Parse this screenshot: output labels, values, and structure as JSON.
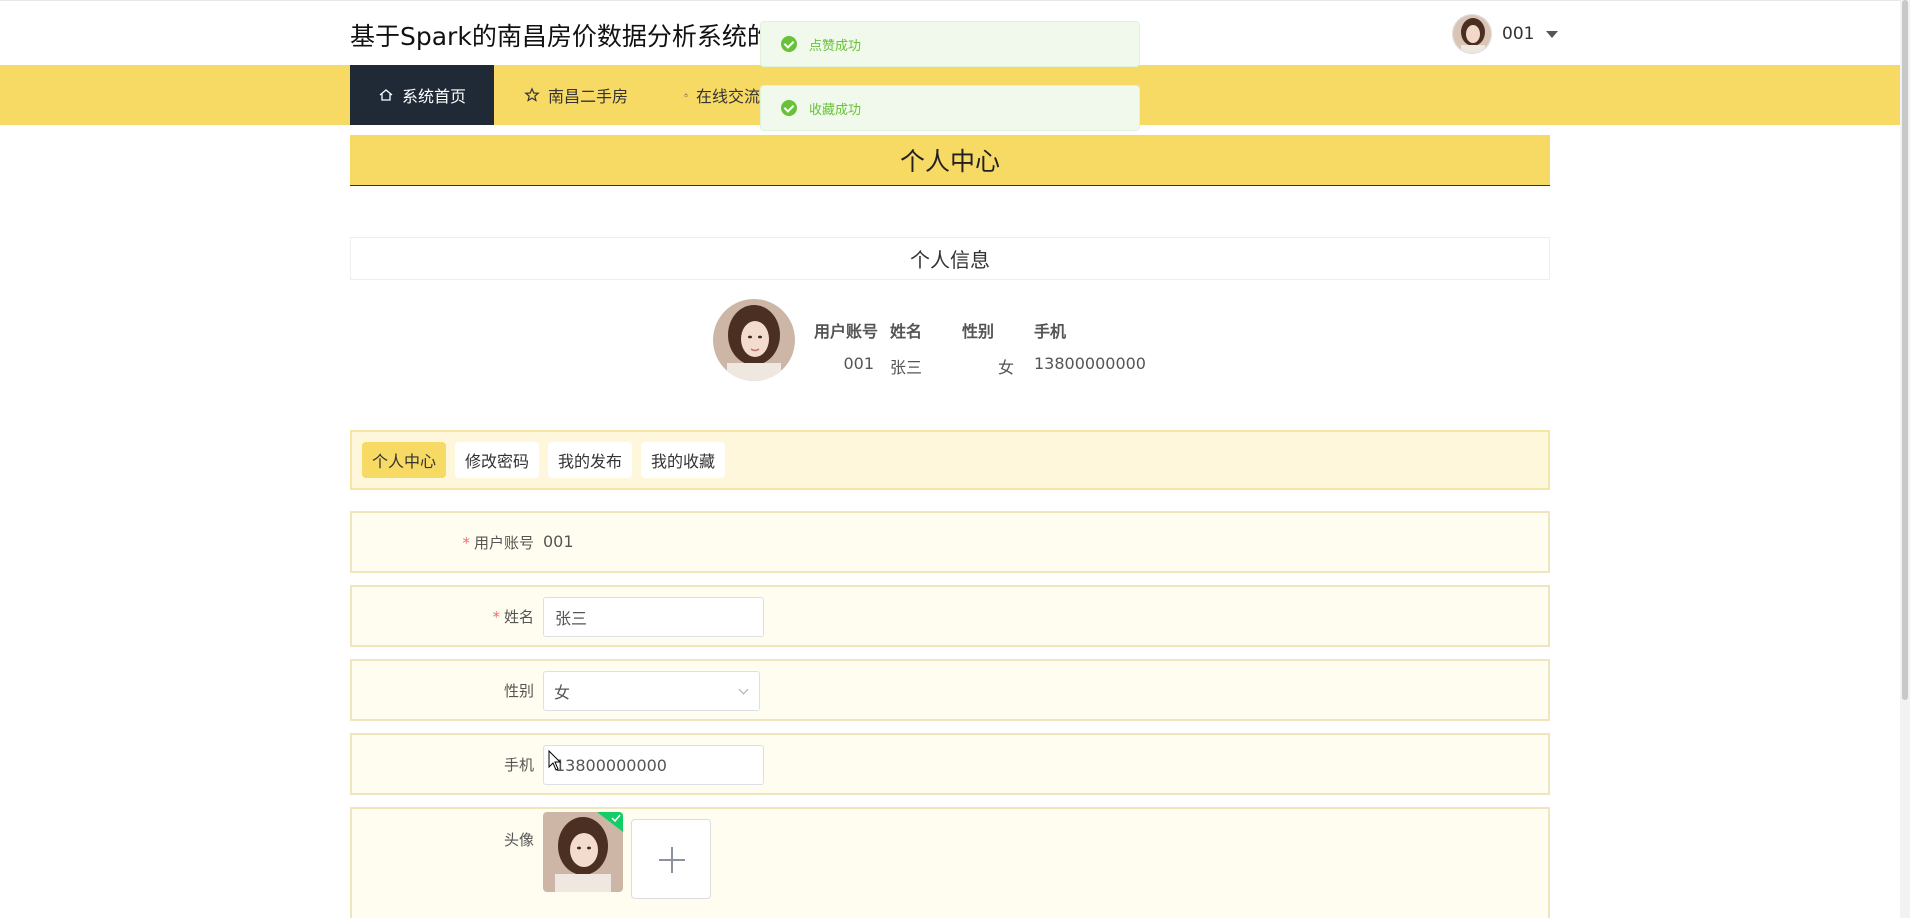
{
  "header": {
    "site_title": "基于Spark的南昌房价数据分析系统的设",
    "username": "001"
  },
  "nav": [
    {
      "label": "系统首页",
      "icon": "home-icon"
    },
    {
      "label": "南昌二手房",
      "icon": "star-icon"
    },
    {
      "label": "在线交流",
      "icon": "lock-icon"
    }
  ],
  "toasts": [
    "点赞成功",
    "收藏成功"
  ],
  "page": {
    "title": "个人中心",
    "info_title": "个人信息"
  },
  "profile": {
    "headers": [
      "用户账号",
      "姓名",
      "性别",
      "手机"
    ],
    "values": [
      "001",
      "张三",
      "女",
      "13800000000"
    ]
  },
  "tabs": [
    "个人中心",
    "修改密码",
    "我的发布",
    "我的收藏"
  ],
  "form": {
    "account_label": "用户账号",
    "account_value": "001",
    "name_label": "姓名",
    "name_value": "张三",
    "gender_label": "性别",
    "gender_value": "女",
    "phone_label": "手机",
    "phone_value": "13800000000",
    "avatar_label": "头像"
  },
  "colors": {
    "nav_bg": "#f7da63",
    "nav_active": "#1f2a36",
    "success": "#67c23a",
    "required": "#f56c6c"
  }
}
